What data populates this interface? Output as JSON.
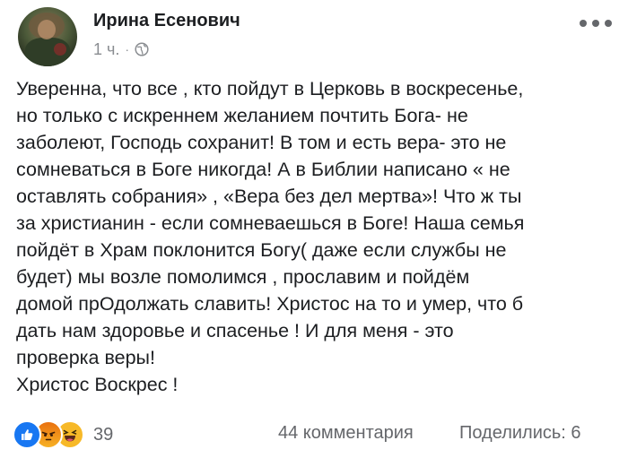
{
  "post": {
    "author": "Ирина Есенович",
    "time": "1 ч.",
    "separator": "·",
    "privacy_icon": "globe-icon",
    "more_icon": "more-options-icon",
    "text_lines": [
      "Уверенна, что все , кто пойдут в Церковь в воскресенье,",
      "но только с искреннем желанием почтить Бога- не",
      "заболеют, Господь сохранит! В том и есть вера- это не",
      "сомневаться в Боге никогда! А в Библии написано « не",
      "оставлять собрания» , «Вера без дел мертва»! Что ж ты",
      "за христианин - если сомневаешься в Боге! Наша семья",
      "пойдёт в Храм поклонится Богу( даже если службы не",
      "будет) мы возле помолимся , прославим и пойдём",
      "домой прОдолжать славить! Христос на то и умер, что б",
      "дать нам здоровье и спасенье ! И для меня - это",
      "проверка веры!",
      "Христос Воскрес !"
    ]
  },
  "footer": {
    "reactions": [
      "like-icon",
      "angry-icon",
      "haha-icon"
    ],
    "reaction_count": "39",
    "comments": "44 комментария",
    "shares": "Поделились: 6"
  },
  "colors": {
    "text": "#1c1e21",
    "secondary": "#65676b",
    "like_blue": "#1877f2",
    "angry_orange": "#e9710f",
    "haha_yellow": "#f7b928"
  }
}
